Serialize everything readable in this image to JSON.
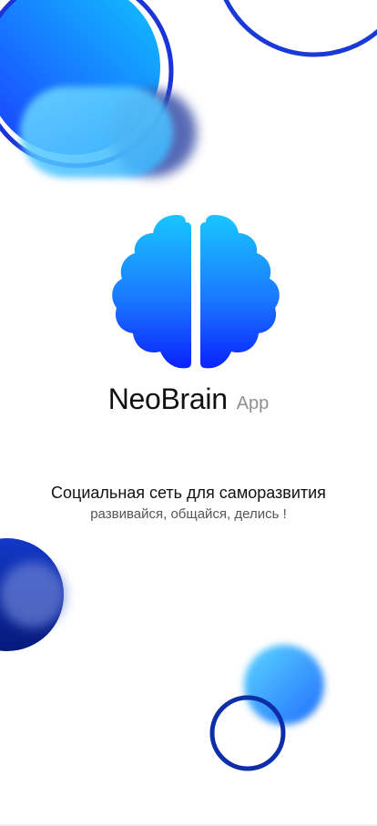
{
  "app": {
    "brand_name": "NeoBrain",
    "brand_suffix": "App",
    "tagline": "Социальная сеть  для саморазвития",
    "subtagline": "развивайся, общайся, делись !"
  },
  "icons": {
    "logo": "brain-icon"
  },
  "colors": {
    "accent_light": "#1ec3ff",
    "accent_dark": "#0a22ff",
    "navy": "#0b2a9c",
    "ring": "#1f3fd6",
    "text_primary": "#111111",
    "text_muted": "#8f8f8f"
  }
}
